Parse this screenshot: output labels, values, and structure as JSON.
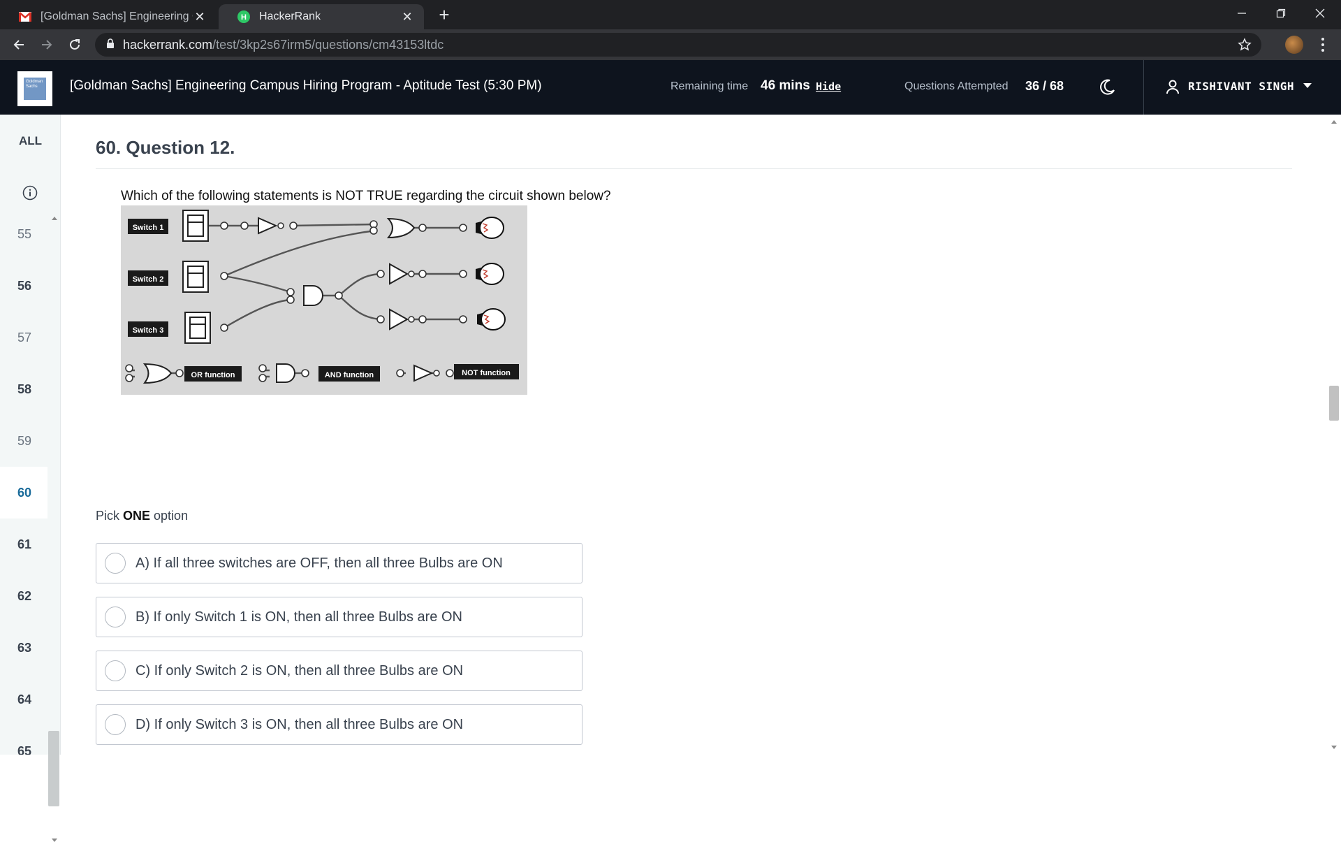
{
  "browser": {
    "tabs": [
      {
        "title": "[Goldman Sachs] Engineering Campus Hiring",
        "active": false,
        "icon": "gmail-icon"
      },
      {
        "title": "HackerRank",
        "active": true,
        "icon": "hackerrank-icon"
      }
    ],
    "url_host": "hackerrank.com",
    "url_path": "/test/3kp2s67irm5/questions/cm43153ltdc"
  },
  "header": {
    "test_title": "[Goldman Sachs] Engineering Campus Hiring Program - Aptitude Test (5:30 PM)",
    "remaining_label": "Remaining time",
    "remaining_value": "46 mins",
    "hide_label": "Hide",
    "attempted_label": "Questions Attempted",
    "attempted_value": "36 / 68",
    "user_name": "RISHIVANT SINGH",
    "logo_text": "Goldman Sachs"
  },
  "sidebar": {
    "all_label": "ALL",
    "questions": [
      {
        "num": "55",
        "style": "dim"
      },
      {
        "num": "56",
        "style": "bold"
      },
      {
        "num": "57",
        "style": "dim"
      },
      {
        "num": "58",
        "style": "bold"
      },
      {
        "num": "59",
        "style": "dim"
      },
      {
        "num": "60",
        "style": "current"
      },
      {
        "num": "61",
        "style": "bold"
      },
      {
        "num": "62",
        "style": "bold"
      },
      {
        "num": "63",
        "style": "bold"
      },
      {
        "num": "64",
        "style": "bold"
      },
      {
        "num": "65",
        "style": "bold"
      }
    ]
  },
  "question": {
    "title": "60. Question 12.",
    "text": "Which of the following statements is NOT TRUE regarding the circuit shown below?",
    "figure": {
      "switch_labels": [
        "Switch 1",
        "Switch 2",
        "Switch 3"
      ],
      "legend": [
        "OR function",
        "AND function",
        "NOT function"
      ]
    },
    "pick_prefix": "Pick ",
    "pick_strong": "ONE",
    "pick_suffix": " option",
    "options": [
      "A) If all three switches are OFF, then all three Bulbs are ON",
      "B) If only Switch 1 is ON, then all three Bulbs are ON",
      "C) If only Switch 2 is ON, then all three Bulbs are ON",
      "D) If only Switch 3 is ON, then all three Bulbs are ON"
    ]
  },
  "colors": {
    "header_bg": "#0e141e",
    "sidebar_bg": "#f3f7f7",
    "current_question": "#1a6b9a"
  }
}
